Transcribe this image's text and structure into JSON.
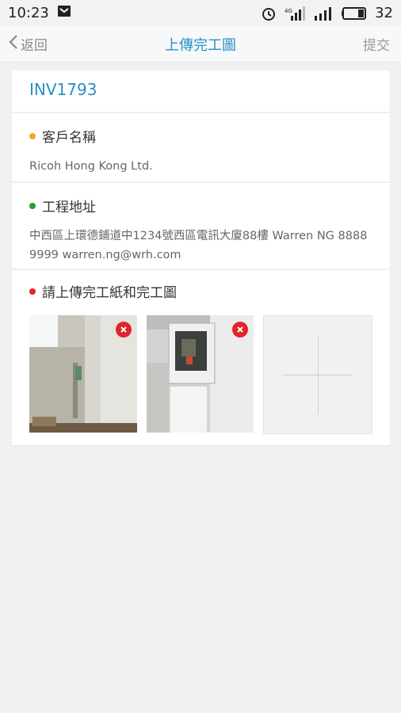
{
  "status_bar": {
    "time": "10:23",
    "battery": "32"
  },
  "nav": {
    "back_label": "返回",
    "title": "上傳完工圖",
    "submit_label": "提交"
  },
  "job": {
    "invoice_no": "INV1793"
  },
  "customer": {
    "label": "客戶名稱",
    "value": "Ricoh Hong Kong Ltd.",
    "dot_color": "#f5a623"
  },
  "address": {
    "label": "工程地址",
    "value": "中西區上環德鋪道中1234號西區電訊大廈88樓 Warren NG 8888 9999 warren.ng@wrh.com",
    "dot_color": "#2a9d3a"
  },
  "upload": {
    "label": "請上傳完工紙和完工圖",
    "dot_color": "#e0242c",
    "photos": [
      {
        "icon": "remove-icon"
      },
      {
        "icon": "remove-icon"
      }
    ],
    "add_icon": "plus-icon"
  },
  "colors": {
    "accent": "#2a8fc4",
    "background": "#f0f1f3"
  }
}
